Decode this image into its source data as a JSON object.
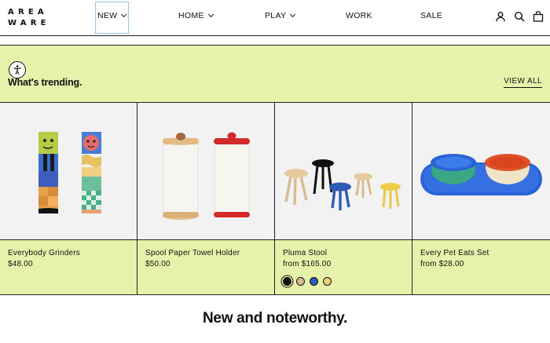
{
  "logo": {
    "line1": "AREA",
    "line2": "WARE"
  },
  "nav": {
    "items": [
      {
        "label": "NEW",
        "has_dropdown": true
      },
      {
        "label": "HOME",
        "has_dropdown": true
      },
      {
        "label": "PLAY",
        "has_dropdown": true
      },
      {
        "label": "WORK",
        "has_dropdown": false
      },
      {
        "label": "SALE",
        "has_dropdown": false
      }
    ]
  },
  "header_icons": [
    "account-icon",
    "search-icon",
    "cart-icon"
  ],
  "trending": {
    "title": "What's trending.",
    "view_all": "VIEW ALL"
  },
  "products": [
    {
      "name": "Everybody Grinders",
      "price": "$48.00"
    },
    {
      "name": "Spool Paper Towel Holder",
      "price": "$50.00"
    },
    {
      "name": "Pluma Stool",
      "price": "from $165.00",
      "swatches": [
        "#111111",
        "#d9bb93",
        "#2e5bb8",
        "#e8d07a"
      ]
    },
    {
      "name": "Every Pet Eats Set",
      "price": "from $28.00"
    }
  ],
  "noteworthy": {
    "title": "New and noteworthy."
  },
  "colors": {
    "accent_band": "#e6f2a9",
    "border": "#222222",
    "focus": "#9ec7e6"
  }
}
